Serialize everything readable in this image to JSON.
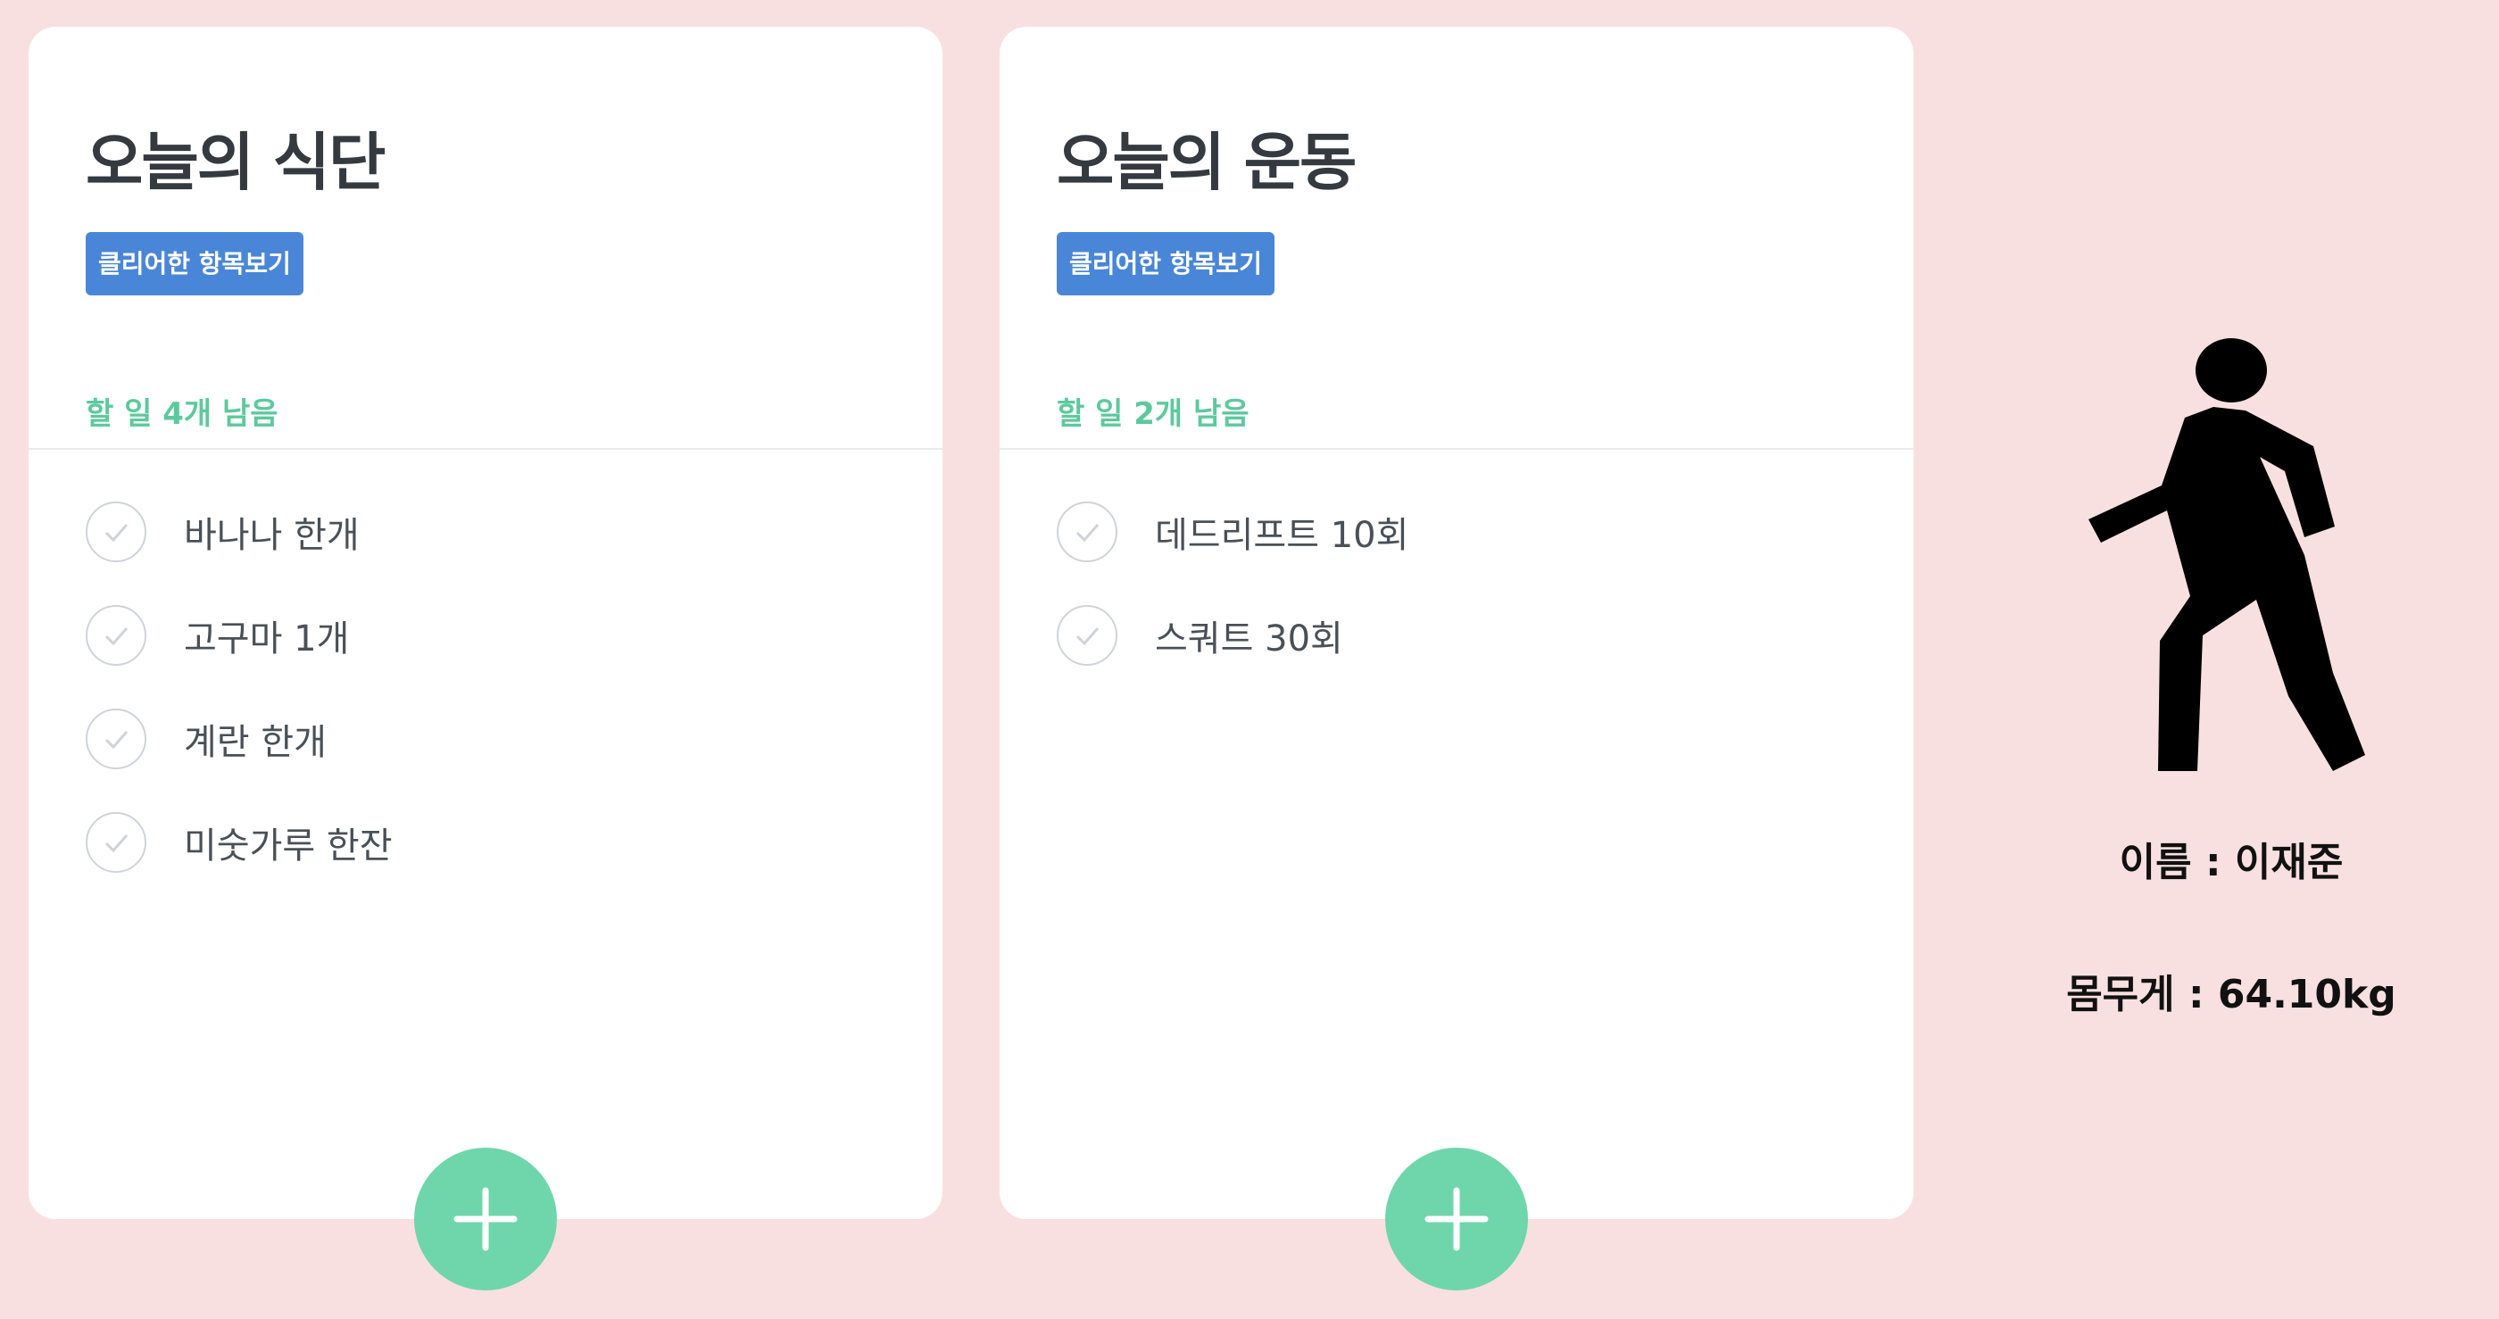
{
  "colors": {
    "page_background": "#f9e0e0",
    "card_background": "#ffffff",
    "button_blue": "#4a86d8",
    "remaining_green": "#5cc99c",
    "add_button_green": "#6fd6ab"
  },
  "diet": {
    "title": "오늘의 식단",
    "clear_button": "클리어한 항목보기",
    "remaining": "할 일 4개 남음",
    "items": [
      "바나나 한개",
      "고구마 1개",
      "계란 한개",
      "미숫가루 한잔"
    ],
    "add_icon": "plus-icon"
  },
  "exercise": {
    "title": "오늘의 운동",
    "clear_button": "클리어한 항목보기",
    "remaining": "할 일 2개 남음",
    "items": [
      "데드리프트 10회",
      "스쿼트 30회"
    ],
    "add_icon": "plus-icon"
  },
  "profile": {
    "icon": "walking-person-icon",
    "name": "이름 : 이재준",
    "weight": "몸무게 : 64.10kg"
  }
}
